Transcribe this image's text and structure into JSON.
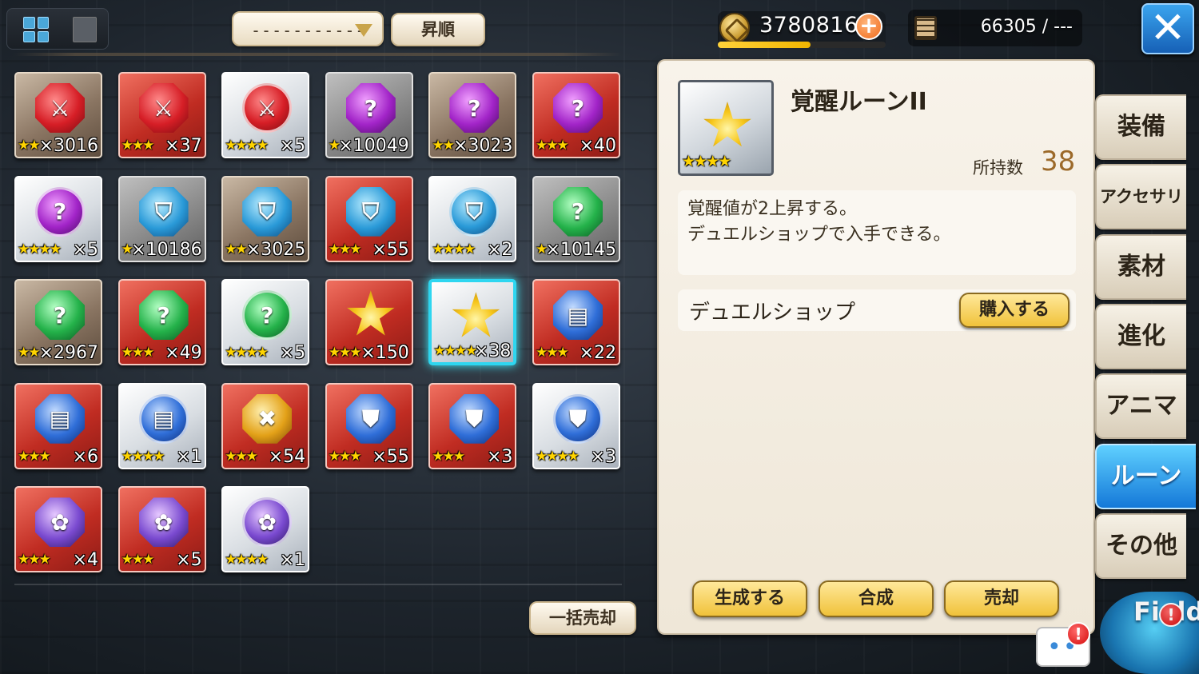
{
  "toolbar": {
    "view_grid_icon": "grid-view-icon",
    "view_list_icon": "list-view-icon",
    "filter_value": "-----------",
    "sort_order_label": "昇順"
  },
  "currency": {
    "coin_value": "3780816",
    "coin_bar_fraction": 0.55,
    "capacity_value": "66305 / ---"
  },
  "close_label": "✕",
  "items": [
    {
      "rarity": "r-brown",
      "color": "c-red",
      "shape": "gem",
      "glyph": "⚔",
      "stars": "★★",
      "qty": "×3016"
    },
    {
      "rarity": "r-red",
      "color": "c-red",
      "shape": "gem",
      "glyph": "⚔",
      "stars": "★★★",
      "qty": "×37"
    },
    {
      "rarity": "r-silver",
      "color": "c-red",
      "shape": "round",
      "glyph": "⚔",
      "stars": "★★★★",
      "qty": "×5"
    },
    {
      "rarity": "r-grey",
      "color": "c-purple",
      "shape": "gem",
      "glyph": "?",
      "stars": "★",
      "qty": "×10049"
    },
    {
      "rarity": "r-brown",
      "color": "c-purple",
      "shape": "gem",
      "glyph": "?",
      "stars": "★★",
      "qty": "×3023"
    },
    {
      "rarity": "r-red",
      "color": "c-purple",
      "shape": "gem",
      "glyph": "?",
      "stars": "★★★",
      "qty": "×40"
    },
    {
      "rarity": "r-silver",
      "color": "c-purple",
      "shape": "round",
      "glyph": "?",
      "stars": "★★★★",
      "qty": "×5"
    },
    {
      "rarity": "r-grey",
      "color": "c-blue",
      "shape": "gem",
      "glyph": "⛉",
      "stars": "★",
      "qty": "×10186"
    },
    {
      "rarity": "r-brown",
      "color": "c-blue",
      "shape": "gem",
      "glyph": "⛉",
      "stars": "★★",
      "qty": "×3025"
    },
    {
      "rarity": "r-red",
      "color": "c-blue",
      "shape": "gem",
      "glyph": "⛉",
      "stars": "★★★",
      "qty": "×55"
    },
    {
      "rarity": "r-silver",
      "color": "c-blue",
      "shape": "round",
      "glyph": "⛉",
      "stars": "★★★★",
      "qty": "×2"
    },
    {
      "rarity": "r-grey",
      "color": "c-green",
      "shape": "gem",
      "glyph": "?",
      "stars": "★",
      "qty": "×10145"
    },
    {
      "rarity": "r-brown",
      "color": "c-green",
      "shape": "gem",
      "glyph": "?",
      "stars": "★★",
      "qty": "×2967"
    },
    {
      "rarity": "r-red",
      "color": "c-green",
      "shape": "gem",
      "glyph": "?",
      "stars": "★★★",
      "qty": "×49"
    },
    {
      "rarity": "r-silver",
      "color": "c-green",
      "shape": "round",
      "glyph": "?",
      "stars": "★★★★",
      "qty": "×5"
    },
    {
      "rarity": "r-red",
      "color": "",
      "shape": "star-shape",
      "glyph": "",
      "stars": "★★★",
      "qty": "×150"
    },
    {
      "rarity": "r-silver",
      "color": "",
      "shape": "star-shape",
      "glyph": "",
      "stars": "★★★★",
      "qty": "×38",
      "selected": true
    },
    {
      "rarity": "r-red",
      "color": "c-bookblue",
      "shape": "gem",
      "glyph": "▤",
      "stars": "★★★",
      "qty": "×22"
    },
    {
      "rarity": "r-red",
      "color": "c-bookblue",
      "shape": "gem",
      "glyph": "▤",
      "stars": "★★★",
      "qty": "×6"
    },
    {
      "rarity": "r-silver",
      "color": "c-bookblue",
      "shape": "round",
      "glyph": "▤",
      "stars": "★★★★",
      "qty": "×1"
    },
    {
      "rarity": "r-red",
      "color": "c-gold",
      "shape": "gem",
      "glyph": "✖",
      "stars": "★★★",
      "qty": "×54"
    },
    {
      "rarity": "r-red",
      "color": "c-bookblue",
      "shape": "gem",
      "glyph": "⛊",
      "stars": "★★★",
      "qty": "×55"
    },
    {
      "rarity": "r-red",
      "color": "c-bookblue",
      "shape": "gem",
      "glyph": "⛊",
      "stars": "★★★",
      "qty": "×3"
    },
    {
      "rarity": "r-silver",
      "color": "c-bookblue",
      "shape": "round",
      "glyph": "⛊",
      "stars": "★★★★",
      "qty": "×3"
    },
    {
      "rarity": "r-red",
      "color": "c-violet",
      "shape": "gem",
      "glyph": "✿",
      "stars": "★★★",
      "qty": "×4"
    },
    {
      "rarity": "r-red",
      "color": "c-violet",
      "shape": "gem",
      "glyph": "✿",
      "stars": "★★★",
      "qty": "×5"
    },
    {
      "rarity": "r-silver",
      "color": "c-violet",
      "shape": "round",
      "glyph": "✿",
      "stars": "★★★★",
      "qty": "×1"
    }
  ],
  "bulk_sell_label": "一括売却",
  "detail": {
    "stars": "★★★★",
    "name": "覚醒ルーンII",
    "owned_label": "所持数",
    "owned_value": "38",
    "desc_line1": "覚醒値が2上昇する。",
    "desc_line2": "デュエルショップで入手できる。",
    "source_label": "デュエルショップ",
    "buy_label": "購入する",
    "create_label": "生成する",
    "combine_label": "合成",
    "sell_label": "売却"
  },
  "tabs": [
    {
      "label": "装備",
      "active": false
    },
    {
      "label": "アクセサリ",
      "active": false
    },
    {
      "label": "素材",
      "active": false
    },
    {
      "label": "進化",
      "active": false
    },
    {
      "label": "アニマ",
      "active": false
    },
    {
      "label": "ルーン",
      "active": true
    },
    {
      "label": "その他",
      "active": false
    }
  ],
  "chat": {
    "dots": "••",
    "alert": "!"
  },
  "field": {
    "label": "Field",
    "alert": "!"
  }
}
